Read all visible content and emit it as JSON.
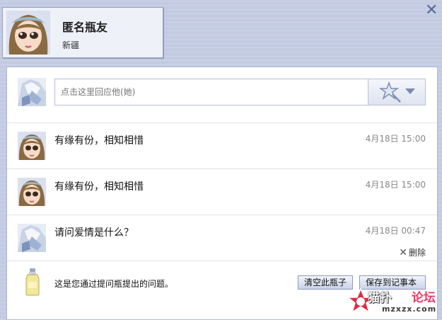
{
  "window": {
    "close_glyph": "✕"
  },
  "profile": {
    "name": "匿名瓶友",
    "location": "新疆"
  },
  "reply": {
    "placeholder": "点击这里回应他(她)",
    "emote_icon": "star-wand-icon"
  },
  "messages": [
    {
      "text": "有缘有份，相知相惜",
      "time": "4月18日 15:00",
      "avatar": "girl-avatar"
    },
    {
      "text": "有缘有份，相知相惜",
      "time": "4月18日 15:00",
      "avatar": "girl-avatar"
    },
    {
      "text": "请问爱情是什么？",
      "time": "4月18日 00:47",
      "avatar": "boy-avatar",
      "delete_label": "删除"
    }
  ],
  "footer": {
    "note": "这是您通过提问瓶提出的问题。",
    "clear_button": "清空此瓶子",
    "save_button": "保存到记事本"
  },
  "watermark": {
    "site_name_a": "猫扑",
    "site_name_b": "论坛",
    "site_url": "mzxzx.com"
  },
  "colors": {
    "frame": "#c3cbe2",
    "panel_border": "#aeb8d3",
    "button_border": "#8d9ac0",
    "time_text": "#888888"
  }
}
